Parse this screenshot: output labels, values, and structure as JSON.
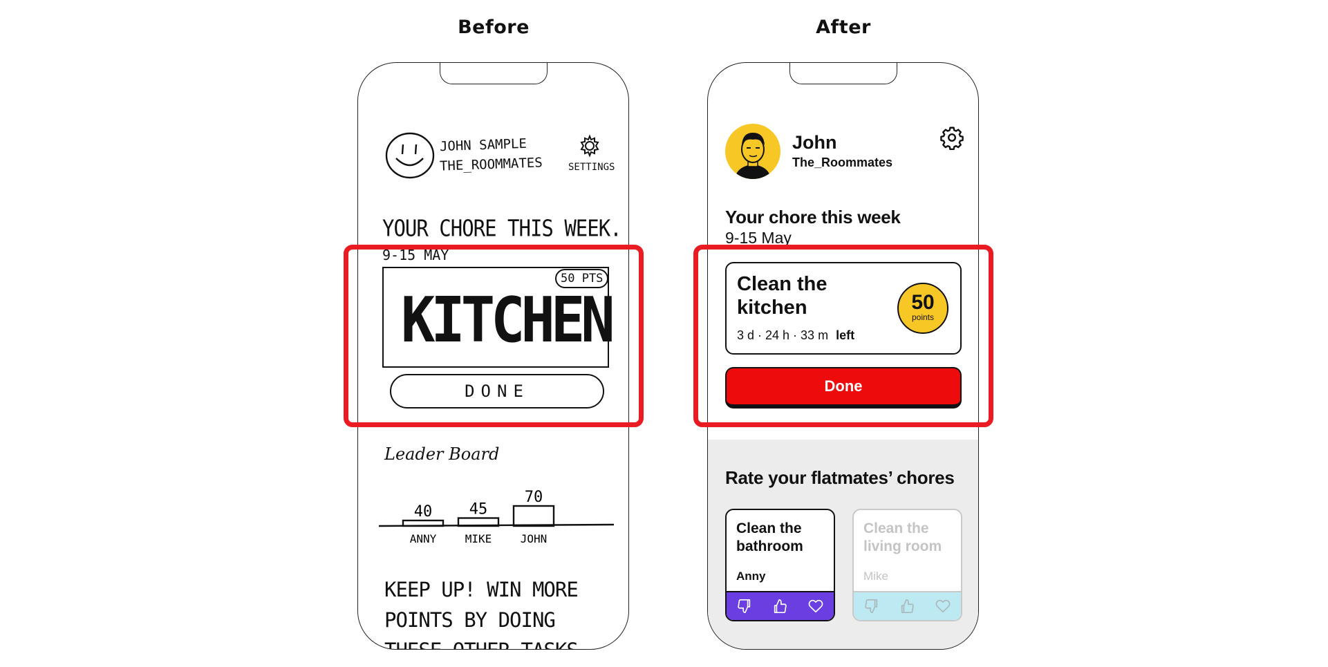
{
  "headings": {
    "before": "Before",
    "after": "After"
  },
  "before": {
    "profile_name": "JOHN SAMPLE",
    "profile_group": "THE_ROOMMATES",
    "settings_label": "SETTINGS",
    "chore_heading": "YOUR CHORE THIS WEEK.",
    "chore_dates": "9-15 MAY",
    "chore_name": "KITCHEN",
    "points_badge": "50 PTS",
    "done_label": "DONE",
    "leaderboard_title": "Leader Board",
    "leaderboard": [
      {
        "name": "ANNY",
        "score": "40",
        "value": 40
      },
      {
        "name": "MIKE",
        "score": "45",
        "value": 45
      },
      {
        "name": "JOHN",
        "score": "70",
        "value": 70
      }
    ],
    "keep_up_text": "KEEP UP! WIN MORE POINTS BY DOING THESE OTHER TASKS"
  },
  "after": {
    "user_name": "John",
    "group_name": "The_Roommates",
    "avatar_icon": "avatar-face-icon",
    "settings_icon": "gear-icon",
    "chore_heading": "Your chore this week",
    "chore_dates": "9-15 May",
    "chore_title_line1": "Clean the",
    "chore_title_line2": "kitchen",
    "time_left": "3 d · 24 h · 33 m",
    "time_left_suffix": "left",
    "points_value": "50",
    "points_label": "points",
    "done_label": "Done",
    "rate_heading": "Rate your flatmates’ chores",
    "rate_cards": [
      {
        "title_line1": "Clean the",
        "title_line2": "bathroom",
        "person": "Anny",
        "state": "active"
      },
      {
        "title_line1": "Clean the",
        "title_line2": "living room",
        "person": "Mike",
        "state": "inactive"
      }
    ],
    "rate_icons": [
      "thumbs-down-icon",
      "thumbs-up-icon",
      "heart-icon"
    ]
  },
  "colors": {
    "highlight": "#ea1b23",
    "done_button": "#ee0b0b",
    "points_badge": "#f7c726",
    "avatar_bg": "#f7c726",
    "rate_active_bar": "#6a3ee0",
    "rate_inactive_bar": "#bde9f2",
    "gray_area": "#ececec"
  }
}
